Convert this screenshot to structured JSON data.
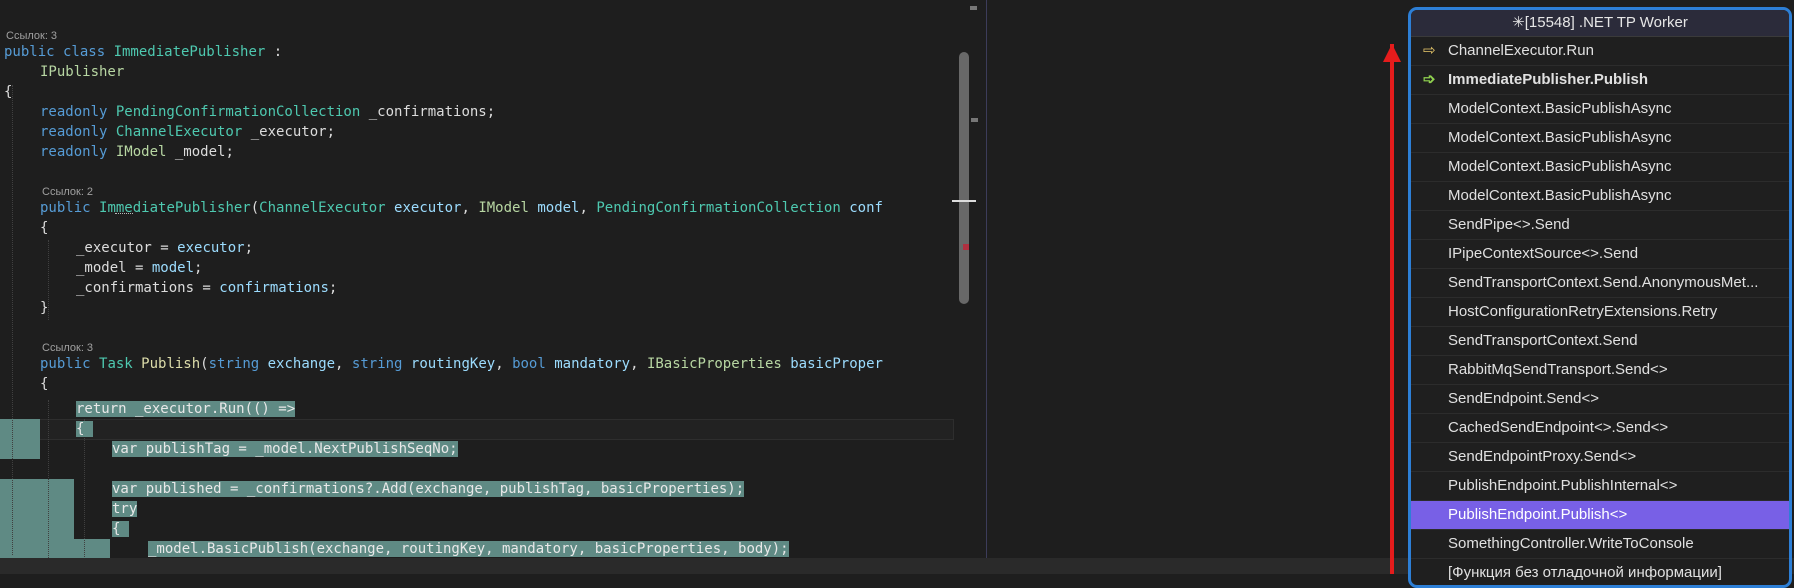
{
  "editor": {
    "lens1": "Ссылок: 3",
    "lens2": "Ссылок: 2",
    "lens3": "Ссылок: 3",
    "l_class_kw": "public class ",
    "l_class_name": "ImmediatePublisher",
    "l_class_colon": " :",
    "l_iface": "IPublisher",
    "l_brace_open": "{",
    "l_f1_kw": "readonly ",
    "l_f1_type": "PendingConfirmationCollection",
    "l_f1_name": " _confirmations;",
    "l_f2_kw": "readonly ",
    "l_f2_type": "ChannelExecutor",
    "l_f2_name": " _executor;",
    "l_f3_kw": "readonly ",
    "l_f3_type": "IModel",
    "l_f3_name": " _model;",
    "l_ctor_kw": "public ",
    "l_ctor_name": "ImmediatePublisher",
    "l_ctor_p1t": "ChannelExecutor",
    "l_ctor_p1n": " executor",
    "l_ctor_p2t": "IModel",
    "l_ctor_p2n": " model",
    "l_ctor_p3t": "PendingConfirmationCollection",
    "l_ctor_p3n": " conf",
    "l_a1_l": "_executor = ",
    "l_a1_r": "executor",
    "l_a2_l": "_model = ",
    "l_a2_r": "model",
    "l_a3_l": "_confirmations = ",
    "l_a3_r": "confirmations",
    "l_pub_kw": "public ",
    "l_pub_type": "Task",
    "l_pub_name": " Publish",
    "l_pub_p1t": "string",
    "l_pub_p1n": " exchange",
    "l_pub_p2t": "string",
    "l_pub_p2n": " routingKey",
    "l_pub_p3t": "bool",
    "l_pub_p3n": " mandatory",
    "l_pub_p4t": "IBasicProperties",
    "l_pub_p4n": " basicProper",
    "l_ret": "return _executor.Run(() =>",
    "l_var1": "var publishTag = _model.NextPublishSeqNo;",
    "l_var2": "var published = _confirmations?.Add(exchange, publishTag, basicProperties);",
    "l_try": "try",
    "l_basic": "_model.BasicPublish(exchange, routingKey, mandatory, basicProperties, body);"
  },
  "call_stack": {
    "title": "[15548] .NET TP Worker",
    "title_icon": "thread-icon",
    "frames": [
      {
        "label": "ChannelExecutor.Run",
        "icon": "return-arrow-icon",
        "glyph": "⇨"
      },
      {
        "label": "ImmediatePublisher.Publish",
        "icon": "current-frame-arrow-icon",
        "glyph": "➩"
      },
      {
        "label": "ModelContext.BasicPublishAsync"
      },
      {
        "label": "ModelContext.BasicPublishAsync"
      },
      {
        "label": "ModelContext.BasicPublishAsync"
      },
      {
        "label": "ModelContext.BasicPublishAsync"
      },
      {
        "label": "SendPipe<>.Send"
      },
      {
        "label": "IPipeContextSource<>.Send"
      },
      {
        "label": "SendTransportContext.Send.AnonymousMet..."
      },
      {
        "label": "HostConfigurationRetryExtensions.Retry"
      },
      {
        "label": "SendTransportContext.Send"
      },
      {
        "label": "RabbitMqSendTransport.Send<>"
      },
      {
        "label": "SendEndpoint.Send<>"
      },
      {
        "label": "CachedSendEndpoint<>.Send<>"
      },
      {
        "label": "SendEndpointProxy.Send<>"
      },
      {
        "label": "PublishEndpoint.PublishInternal<>"
      },
      {
        "label": "PublishEndpoint.Publish<>"
      },
      {
        "label": "SomethingController.WriteToConsole"
      },
      {
        "label": "[Функция без отладочной информации]"
      }
    ]
  },
  "colors": {
    "accent_border": "#2d7fd6",
    "selected_frame": "#7860e6",
    "annotation_arrow": "#e51c1c",
    "selection_highlight": "#5f8a84"
  }
}
